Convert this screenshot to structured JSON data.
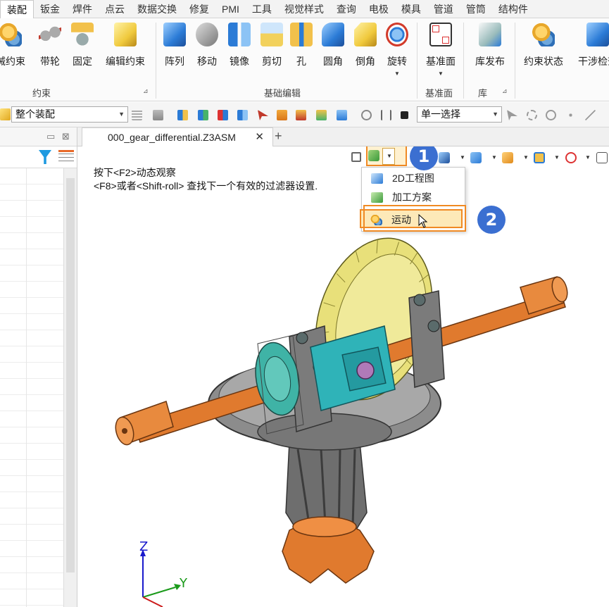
{
  "menu": {
    "tabs": [
      "装配",
      "钣金",
      "焊件",
      "点云",
      "数据交换",
      "修复",
      "PMI",
      "工具",
      "视觉样式",
      "查询",
      "电极",
      "模具",
      "管道",
      "管筒",
      "结构件"
    ],
    "active": "装配"
  },
  "ribbon": {
    "constraint_group": {
      "label": "约束",
      "buttons": [
        "械约束",
        "带轮",
        "固定",
        "编辑约束"
      ]
    },
    "basic_edit_group": {
      "label": "基础编辑",
      "buttons": [
        "阵列",
        "移动",
        "镜像",
        "剪切",
        "孔",
        "圆角",
        "倒角",
        "旋转"
      ]
    },
    "datum_group": {
      "label": "基准面",
      "buttons": [
        "基准面"
      ]
    },
    "library_group": {
      "label": "库",
      "buttons": [
        "库发布"
      ]
    },
    "extra_buttons": [
      "约束状态",
      "干涉检查"
    ]
  },
  "quickbar": {
    "assembly_scope": "整个装配",
    "selection_mode": "单一选择"
  },
  "document": {
    "tab_title": "000_gear_differential.Z3ASM",
    "close_glyph": "✕",
    "add_glyph": "+"
  },
  "viewport": {
    "hint_line1": "按下<F2>动态观察",
    "hint_line2": "<F8>或者<Shift-roll> 查找下一个有效的过滤器设置.",
    "dropdown_items": [
      "2D工程图",
      "加工方案",
      "运动"
    ],
    "highlighted_item": "运动",
    "step_badges": [
      "1",
      "2"
    ],
    "axis_labels": {
      "z": "Z",
      "y": "Y"
    }
  },
  "colors": {
    "accent_orange": "#f08a24",
    "badge_blue": "#3b6fd1",
    "shaft_orange": "#e07a2e",
    "gear_yellow": "#e8e07a",
    "housing_gray": "#8c8c8c",
    "carrier_cyan": "#2fb3b8"
  }
}
